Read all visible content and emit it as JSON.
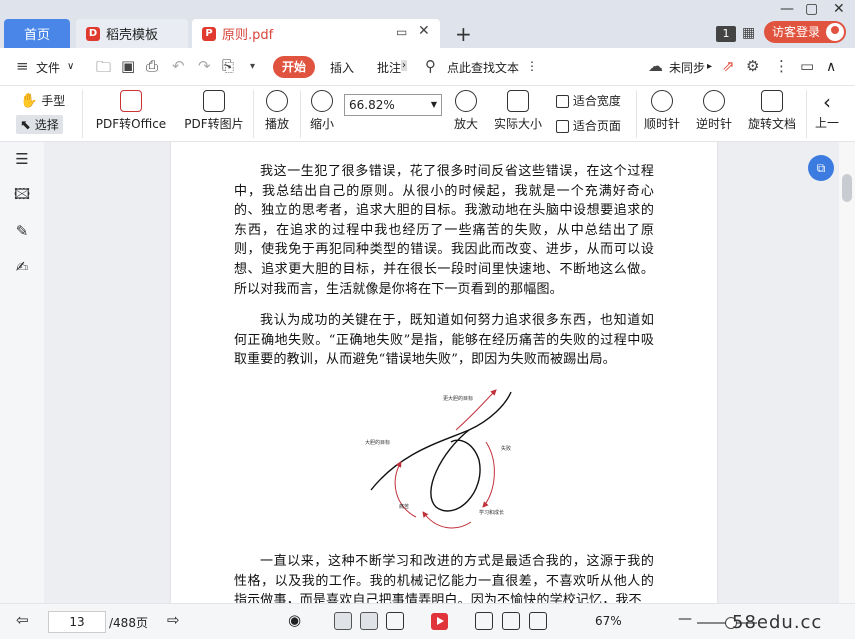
{
  "tabs": {
    "home": "首页",
    "template": "稻壳模板",
    "document": "原则.pdf",
    "new_tab": "+"
  },
  "window": {
    "count_badge": "1",
    "login": "访客登录"
  },
  "menubar": {
    "file": "文件",
    "start": "开始",
    "insert": "插入",
    "annotate": "批注",
    "search": "点此查找文本",
    "sync": "未同步"
  },
  "ribbon": {
    "hand": "手型",
    "select": "选择",
    "pdf_to_office": "PDF转Office",
    "pdf_to_image": "PDF转图片",
    "play": "播放",
    "zoom_out": "缩小",
    "zoom_value": "66.82%",
    "zoom_in": "放大",
    "actual_size": "实际大小",
    "fit_width": "适合宽度",
    "fit_page": "适合页面",
    "rotate_cw": "顺时针",
    "rotate_ccw": "逆时针",
    "rotate_doc": "旋转文档",
    "prev": "上一"
  },
  "document": {
    "para1": "我这一生犯了很多错误，花了很多时间反省这些错误，在这个过程中，我总结出自己的原则。从很小的时候起，我就是一个充满好奇心的、独立的思考者，追求大胆的目标。我激动地在头脑中设想要追求的东西，在追求的过程中我也经历了一些痛苦的失败，从中总结出了原则，使我免于再犯同种类型的错误。我因此而改变、进步，从而可以设想、追求更大胆的目标，并在很长一段时间里快速地、不断地这么做。所以对我而言，生活就像是你将在下一页看到的那幅图。",
    "para2": "我认为成功的关键在于，既知道如何努力追求很多东西，也知道如何正确地失败。“正确地失败”是指，能够在经历痛苦的失败的过程中吸取重要的教训，从而避免“错误地失败”，即因为失败而被踢出局。",
    "para3": "一直以来，这种不断学习和改进的方式是最适合我的，这源于我的性格，以及我的工作。我的机械记忆能力一直很差，不喜欢听从他人的指示做事，而是喜欢自己把事情弄明白。因为不愉快的学校记忆，我不",
    "figure_labels": {
      "top": "更大胆的目标",
      "left": "大胆的目标",
      "right": "失败",
      "bottom_left": "痛苦",
      "bottom_right": "学习和成长"
    }
  },
  "statusbar": {
    "current_page": "13",
    "total_pages": "/488页",
    "zoom": "67%",
    "watermark": "58edu.cc"
  },
  "colors": {
    "accent_red": "#e0533f",
    "tab_blue": "#4a86e8",
    "figure_arrow": "#c0303a"
  }
}
